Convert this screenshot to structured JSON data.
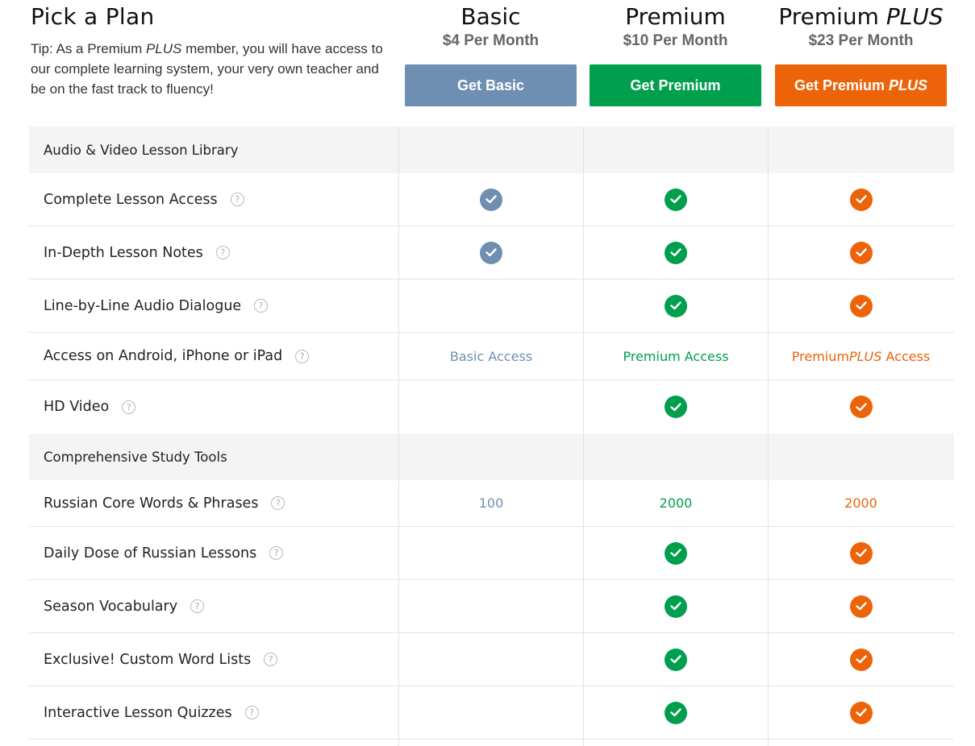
{
  "header": {
    "title": "Pick a Plan",
    "tip_prefix": "Tip: As a Premium ",
    "tip_em": "PLUS",
    "tip_suffix": " member, you will have access to our complete learning system, your very own teacher and be on the fast track to fluency!"
  },
  "plans": {
    "basic": {
      "name": "Basic",
      "price": "$4 Per Month",
      "button": "Get Basic",
      "color": "#6e8fb1"
    },
    "premium": {
      "name": "Premium",
      "price": "$10 Per Month",
      "button": "Get Premium",
      "color": "#009f4d"
    },
    "plus": {
      "name_prefix": "Premium ",
      "name_em": "PLUS",
      "price": "$23 Per Month",
      "button_prefix": "Get Premium ",
      "button_em": "PLUS",
      "color": "#ec6309"
    }
  },
  "sections": [
    {
      "title": "Audio & Video Lesson Library",
      "rows": [
        {
          "label": "Complete Lesson Access",
          "basic": "check",
          "premium": "check",
          "plus": "check"
        },
        {
          "label": "In-Depth Lesson Notes",
          "basic": "check",
          "premium": "check",
          "plus": "check"
        },
        {
          "label": "Line-by-Line Audio Dialogue",
          "basic": "",
          "premium": "check",
          "plus": "check"
        },
        {
          "label": "Access on Android, iPhone or iPad",
          "basic": "Basic Access",
          "premium": "Premium Access",
          "plus_prefix": "Premium ",
          "plus_em": "PLUS",
          "plus_suffix": " Access"
        },
        {
          "label": "HD Video",
          "basic": "",
          "premium": "check",
          "plus": "check"
        }
      ]
    },
    {
      "title": "Comprehensive Study Tools",
      "rows": [
        {
          "label": "Russian Core Words & Phrases",
          "basic": "100",
          "premium": "2000",
          "plus": "2000"
        },
        {
          "label": "Daily Dose of Russian Lessons",
          "basic": "",
          "premium": "check",
          "plus": "check"
        },
        {
          "label": "Season Vocabulary",
          "basic": "",
          "premium": "check",
          "plus": "check"
        },
        {
          "label": "Exclusive! Custom Word Lists",
          "basic": "",
          "premium": "check",
          "plus": "check"
        },
        {
          "label": "Interactive Lesson Quizzes",
          "basic": "",
          "premium": "check",
          "plus": "check"
        }
      ]
    }
  ],
  "icons": {
    "help": "question-circle-icon",
    "check": "checkmark-circle-icon"
  }
}
